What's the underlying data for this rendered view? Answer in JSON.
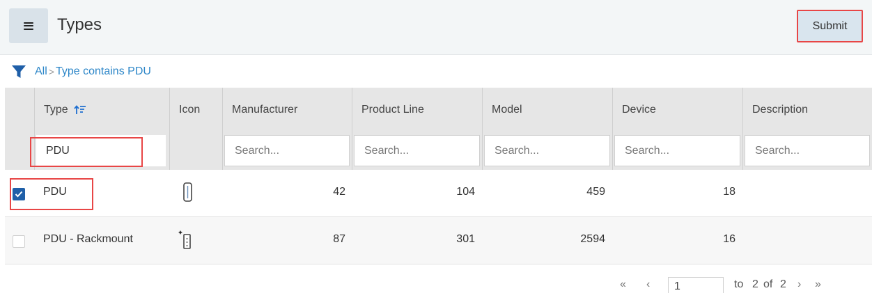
{
  "header": {
    "title": "Types",
    "submit_label": "Submit",
    "menu_icon": "hamburger-menu-icon"
  },
  "filter": {
    "icon": "funnel-icon",
    "root_label": "All",
    "separator": ">",
    "condition_label": "Type contains PDU"
  },
  "table": {
    "columns": [
      {
        "key": "type",
        "label": "Type",
        "sort_icon": "sort-ascending-icon"
      },
      {
        "key": "icon",
        "label": "Icon"
      },
      {
        "key": "manufacturer",
        "label": "Manufacturer"
      },
      {
        "key": "product_line",
        "label": "Product Line"
      },
      {
        "key": "model",
        "label": "Model"
      },
      {
        "key": "device",
        "label": "Device"
      },
      {
        "key": "description",
        "label": "Description"
      }
    ],
    "filters": {
      "type_value": "PDU",
      "placeholder": "Search..."
    },
    "rows": [
      {
        "checked": true,
        "type": "PDU",
        "icon": "pdu-icon",
        "manufacturer": "42",
        "product_line": "104",
        "model": "459",
        "device": "18",
        "description": ""
      },
      {
        "checked": false,
        "type": "PDU - Rackmount",
        "icon": "pdu-rackmount-icon",
        "manufacturer": "87",
        "product_line": "301",
        "model": "2594",
        "device": "16",
        "description": ""
      }
    ]
  },
  "pager": {
    "first_symbol": "«",
    "prev_symbol": "‹",
    "page_value": "1",
    "to_label": "to",
    "to_value": "2",
    "of_label": "of",
    "total": "2",
    "next_symbol": "›",
    "last_symbol": "»"
  },
  "colors": {
    "accent": "#2c86c8",
    "highlight": "#e84646",
    "checkbox": "#1f5fa8",
    "header_bg": "#e6e6e6",
    "topbar_bg": "#f3f6f7"
  }
}
